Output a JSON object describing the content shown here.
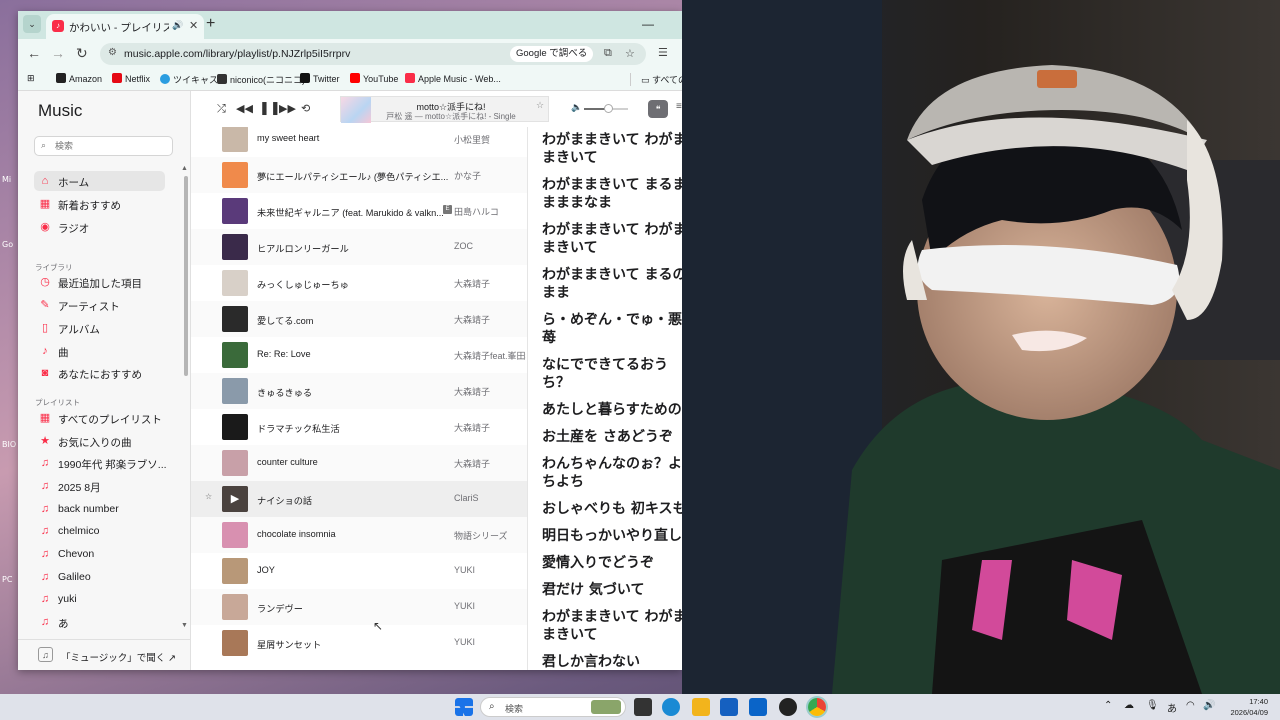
{
  "desktop": {
    "labels": [
      "Mi",
      "Go",
      "BIO",
      "PC"
    ]
  },
  "browser": {
    "tab_title": "かわいい - プレイリスト - Apple",
    "url": "music.apple.com/library/playlist/p.NJZrlp5iI5rrprv",
    "google_search_label": "Google で調べる",
    "bookmarks": [
      "Amazon",
      "Netflix",
      "ツイキャス",
      "niconico(ニコニコ)",
      "Twitter",
      "YouTube",
      "Apple Music - Web..."
    ],
    "bookmarks_folder": "すべての"
  },
  "app": {
    "logo_text": "Music",
    "search_placeholder": "検索",
    "nav": [
      {
        "label": "ホーム",
        "icon": "home-icon"
      },
      {
        "label": "新着おすすめ",
        "icon": "grid-icon"
      },
      {
        "label": "ラジオ",
        "icon": "radio-icon"
      }
    ],
    "library_heading": "ライブラリ",
    "library": [
      {
        "label": "最近追加した項目",
        "icon": "clock-icon"
      },
      {
        "label": "アーティスト",
        "icon": "mic-icon"
      },
      {
        "label": "アルバム",
        "icon": "album-icon"
      },
      {
        "label": "曲",
        "icon": "note-icon"
      },
      {
        "label": "あなたにおすすめ",
        "icon": "person-icon"
      }
    ],
    "playlists_heading": "プレイリスト",
    "playlists": [
      {
        "label": "すべてのプレイリスト",
        "icon": "grid-icon"
      },
      {
        "label": "お気に入りの曲",
        "icon": "star-icon"
      },
      {
        "label": "1990年代 邦楽ラブソ...",
        "icon": "playlist-icon"
      },
      {
        "label": "2025 8月",
        "icon": "playlist-icon"
      },
      {
        "label": "back number",
        "icon": "playlist-icon"
      },
      {
        "label": "chelmico",
        "icon": "playlist-icon"
      },
      {
        "label": "Chevon",
        "icon": "playlist-icon"
      },
      {
        "label": "Galileo",
        "icon": "playlist-icon"
      },
      {
        "label": "yuki",
        "icon": "playlist-icon"
      },
      {
        "label": "あ",
        "icon": "playlist-icon"
      }
    ],
    "open_in_music": "「ミュージック」で聞く ↗"
  },
  "player": {
    "title": "motto☆派手にね!",
    "subtitle": "戸松 遥 — motto☆派手にね! - Single",
    "volume_level": 0.55
  },
  "songs": [
    {
      "title": "my sweet heart",
      "artist": "小松里賀",
      "explicit": false,
      "favorite": false,
      "hover": false,
      "art": "#c9b8a8"
    },
    {
      "title": "夢にエールパティシエール♪ (夢色パティシエ...",
      "artist": "かな子",
      "explicit": false,
      "favorite": false,
      "hover": false,
      "art": "#f08a4b"
    },
    {
      "title": "未来世紀ギャルニア (feat. Marukido & valkn...",
      "artist": "田島ハルコ",
      "explicit": true,
      "favorite": false,
      "hover": false,
      "art": "#5a3a7a"
    },
    {
      "title": "ヒアルロンリーガール",
      "artist": "ZOC",
      "explicit": false,
      "favorite": false,
      "hover": false,
      "art": "#3a2a4a"
    },
    {
      "title": "みっくしゅじゅーちゅ",
      "artist": "大森靖子",
      "explicit": false,
      "favorite": false,
      "hover": false,
      "art": "#d8d0c8"
    },
    {
      "title": "愛してる.com",
      "artist": "大森靖子",
      "explicit": false,
      "favorite": false,
      "hover": false,
      "art": "#2a2a2a"
    },
    {
      "title": "Re: Re: Love",
      "artist": "大森靖子feat.峯田和",
      "explicit": false,
      "favorite": false,
      "hover": false,
      "art": "#3a6a3a"
    },
    {
      "title": "きゅるきゅる",
      "artist": "大森靖子",
      "explicit": false,
      "favorite": false,
      "hover": false,
      "art": "#8a9aaa"
    },
    {
      "title": "ドラマチック私生活",
      "artist": "大森靖子",
      "explicit": false,
      "favorite": false,
      "hover": false,
      "art": "#1a1a1a"
    },
    {
      "title": "counter culture",
      "artist": "大森靖子",
      "explicit": false,
      "favorite": false,
      "hover": false,
      "art": "#c8a0a8"
    },
    {
      "title": "ナイショの話",
      "artist": "ClariS",
      "explicit": false,
      "favorite": true,
      "hover": true,
      "art": "#7a5a4a"
    },
    {
      "title": "chocolate insomnia",
      "artist": "物語シリーズ",
      "explicit": false,
      "favorite": false,
      "hover": false,
      "art": "#d890b0"
    },
    {
      "title": "JOY",
      "artist": "YUKI",
      "explicit": false,
      "favorite": false,
      "hover": false,
      "art": "#b89878"
    },
    {
      "title": "ランデヴー",
      "artist": "YUKI",
      "explicit": false,
      "favorite": false,
      "hover": false,
      "art": "#c8a898"
    },
    {
      "title": "星屑サンセット",
      "artist": "YUKI",
      "explicit": false,
      "favorite": false,
      "hover": false,
      "art": "#a87858"
    }
  ],
  "lyrics": [
    "わがままきいて わがま\nまきいて",
    "わがままきいて まるま\nまままなま",
    "わがままきいて わがま\nまきいて",
    "わがままきいて まるの\nまま",
    "ら・めぞん・でゅ・悪\n苺",
    "なにでできてるおう\nち？",
    "あたしと暮らすための",
    "お土産を さあどうぞ",
    "わんちゃんなのぉ？よ\nちよち",
    "おしゃべりも 初キスも",
    "明日もっかいやり直し",
    "愛情入りでどうぞ",
    "君だけ 気づいて",
    "わがままきいて わがま\nまきいて",
    "君しか言わない"
  ],
  "taskbar": {
    "search_label": "検索",
    "ime_label": "あ",
    "time": "17:40",
    "date": "2026/04/09"
  }
}
